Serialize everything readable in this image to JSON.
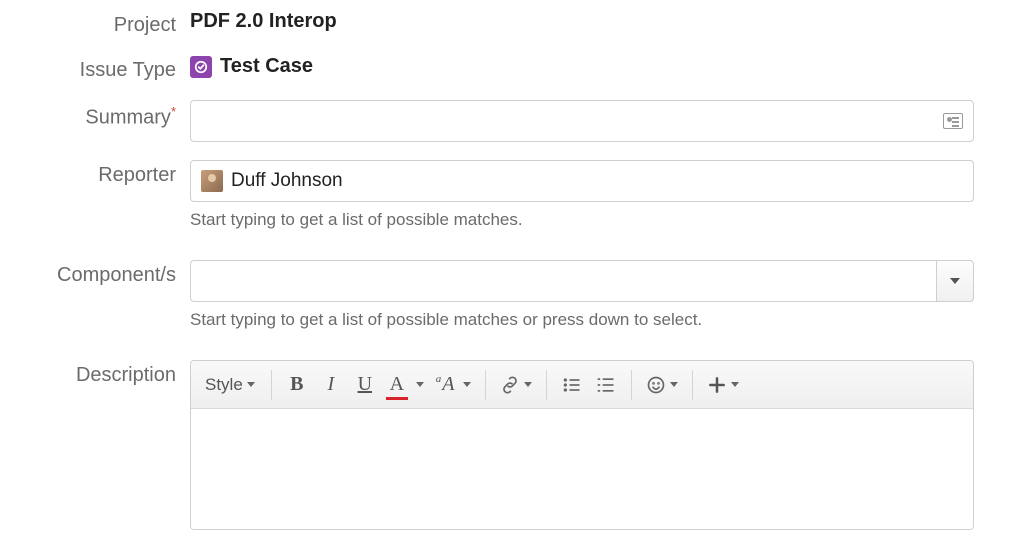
{
  "labels": {
    "project": "Project",
    "issue_type": "Issue Type",
    "summary": "Summary",
    "reporter": "Reporter",
    "components": "Component/s",
    "description": "Description"
  },
  "values": {
    "project": "PDF 2.0 Interop",
    "issue_type": "Test Case",
    "reporter": "Duff Johnson",
    "summary": "",
    "components": ""
  },
  "hints": {
    "reporter": "Start typing to get a list of possible matches.",
    "components": "Start typing to get a list of possible matches or press down to select."
  },
  "toolbar": {
    "style": "Style",
    "bold": "B",
    "italic": "I",
    "underline": "U",
    "color": "A",
    "clear_format": "A"
  }
}
